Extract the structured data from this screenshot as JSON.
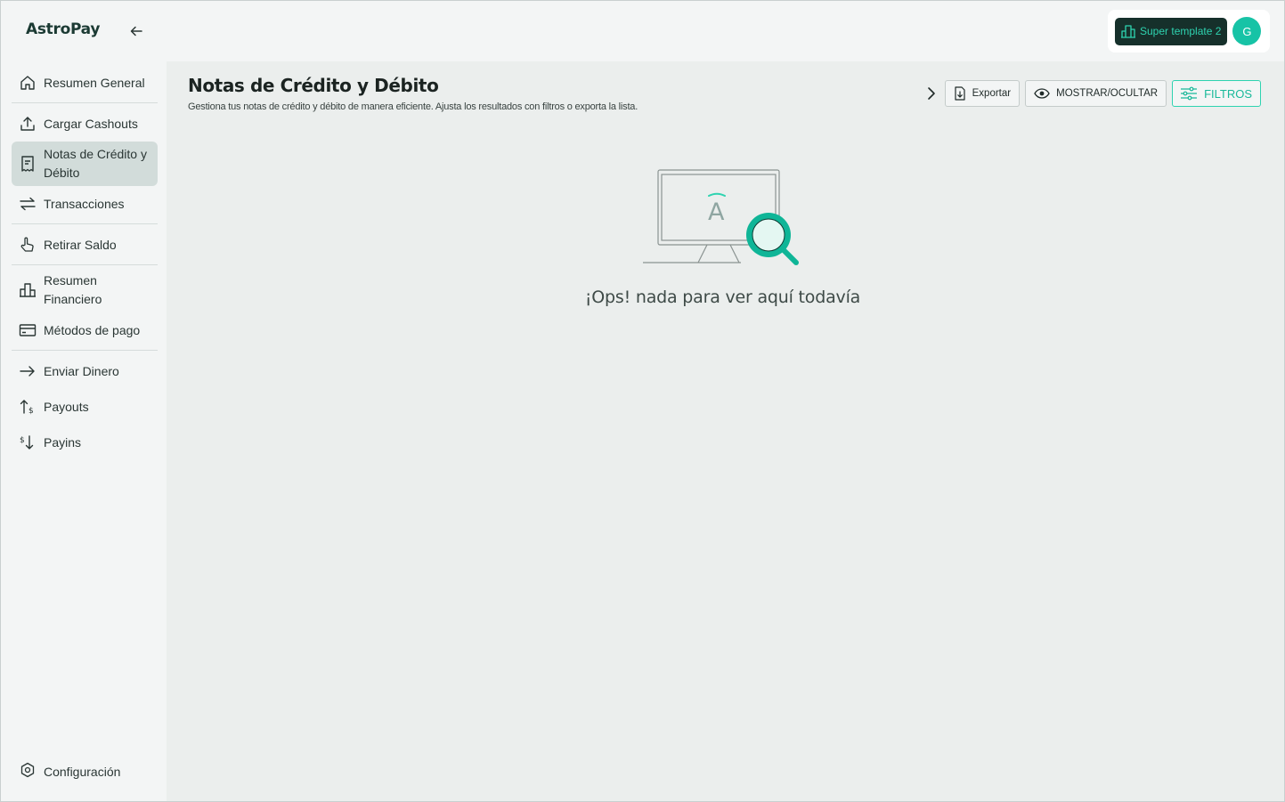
{
  "brand": {
    "logo_text": "AstroPay"
  },
  "sidebar": {
    "items": [
      {
        "label": "Resumen General",
        "icon": "home-icon",
        "active": false
      },
      {
        "label": "Cargar Cashouts",
        "icon": "upload-icon",
        "active": false
      },
      {
        "label": "Notas de Crédito y Débito",
        "icon": "receipt-icon",
        "active": true
      },
      {
        "label": "Transacciones",
        "icon": "transfer-arrows-icon",
        "active": false
      },
      {
        "label": "Retirar Saldo",
        "icon": "hand-tap-icon",
        "active": false
      },
      {
        "label": "Resumen Financiero",
        "icon": "bar-chart-icon",
        "active": false
      },
      {
        "label": "Métodos de pago",
        "icon": "credit-card-icon",
        "active": false
      },
      {
        "label": "Enviar Dinero",
        "icon": "arrow-right-icon",
        "active": false
      },
      {
        "label": "Payouts",
        "icon": "payout-icon",
        "active": false
      },
      {
        "label": "Payins",
        "icon": "payin-icon",
        "active": false
      }
    ],
    "config_label": "Configuración"
  },
  "topbar": {
    "workspace_label": "Super template 2",
    "avatar_initial": "G"
  },
  "page": {
    "title": "Notas de Crédito y Débito",
    "subtitle": "Gestiona tus notas de crédito y débito de manera eficiente. Ajusta los resultados con filtros o exporta la lista.",
    "actions": {
      "export_label": "Exportar",
      "toggle_label": "MOSTRAR/OCULTAR",
      "filters_label": "FILTROS"
    },
    "empty_state": {
      "message": "¡Ops! nada para ver aquí todavía",
      "illustration_letter": "A"
    }
  },
  "colors": {
    "accent": "#2ed3b0",
    "brand_dark": "#16302b",
    "active_nav": "#d2dcda"
  }
}
